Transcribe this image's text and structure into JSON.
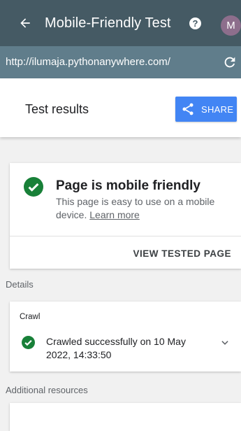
{
  "appbar": {
    "title": "Mobile-Friendly Test",
    "help_icon": "question-mark-icon",
    "back_icon": "arrow-back-icon",
    "avatar_initial": "M",
    "color": "#455a64"
  },
  "urlbar": {
    "url": "http://ilumaja.pythonanywhere.com/",
    "reload_icon": "reload-icon",
    "color": "#607d8b"
  },
  "results_header": {
    "title": "Test results",
    "share_label": "SHARE",
    "share_icon": "share-icon",
    "share_color": "#4285f4"
  },
  "result_card": {
    "title": "Page is mobile friendly",
    "description": "This page is easy to use on a mobile device.",
    "learn_more": "Learn more",
    "view_button": "VIEW TESTED PAGE",
    "status_icon": "check-circle-icon",
    "status_color": "#188038"
  },
  "details": {
    "label": "Details",
    "crawl": {
      "label": "Crawl",
      "status": "Crawled successfully on 10 May 2022, 14:33:50",
      "status_icon": "check-circle-icon",
      "expand_icon": "chevron-down-icon"
    }
  },
  "additional": {
    "label": "Additional resources"
  }
}
